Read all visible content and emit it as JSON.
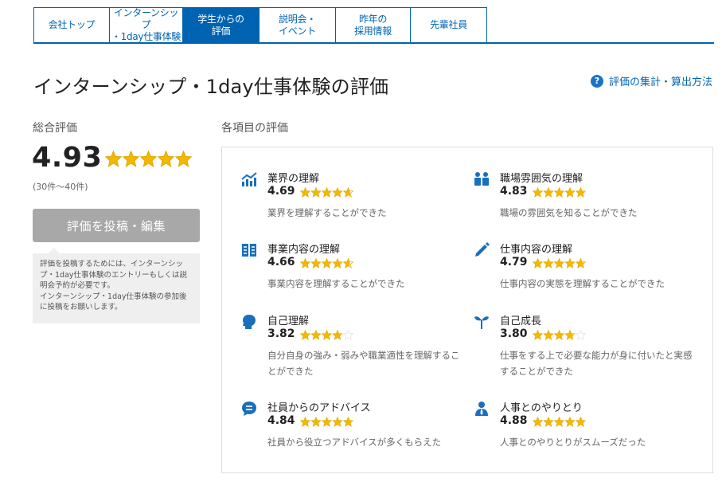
{
  "tabs": [
    {
      "label": "会社トップ",
      "active": false
    },
    {
      "label": "インターンシップ\n・1day仕事体験",
      "active": false
    },
    {
      "label": "学生からの\n評価",
      "active": true
    },
    {
      "label": "説明会・\nイベント",
      "active": false
    },
    {
      "label": "昨年の\n採用情報",
      "active": false
    },
    {
      "label": "先輩社員",
      "active": false
    }
  ],
  "page_title": "インターンシップ・1day仕事体験の評価",
  "method_link": "評価の集計・算出方法",
  "overall": {
    "label": "総合評価",
    "score": "4.93",
    "score_value": 4.93,
    "count": "(30件～40件)",
    "post_button": "評価を投稿・編集",
    "note": "評価を投稿するためには、インターンシップ・1day仕事体験のエントリーもしくは説明会予約が必要です。\nインターンシップ・1day仕事体験の参加後に投稿をお願いします。"
  },
  "items_label": "各項目の評価",
  "items": [
    {
      "icon": "chart-icon",
      "name": "業界の理解",
      "score": "4.69",
      "value": 4.69,
      "desc": "業界を理解することができた"
    },
    {
      "icon": "people-icon",
      "name": "職場雰囲気の理解",
      "score": "4.83",
      "value": 4.83,
      "desc": "職場の雰囲気を知ることができた"
    },
    {
      "icon": "book-icon",
      "name": "事業内容の理解",
      "score": "4.66",
      "value": 4.66,
      "desc": "事業内容を理解することができた"
    },
    {
      "icon": "pencil-icon",
      "name": "仕事内容の理解",
      "score": "4.79",
      "value": 4.79,
      "desc": "仕事内容の実態を理解することができた"
    },
    {
      "icon": "head-icon",
      "name": "自己理解",
      "score": "3.82",
      "value": 3.82,
      "desc": "自分自身の強み・弱みや職業適性を理解することができた"
    },
    {
      "icon": "sprout-icon",
      "name": "自己成長",
      "score": "3.80",
      "value": 3.8,
      "desc": "仕事をする上で必要な能力が身に付いたと実感することができた"
    },
    {
      "icon": "chat-icon",
      "name": "社員からのアドバイス",
      "score": "4.84",
      "value": 4.84,
      "desc": "社員から役立つアドバイスが多くもらえた"
    },
    {
      "icon": "person-icon",
      "name": "人事とのやりとり",
      "score": "4.88",
      "value": 4.88,
      "desc": "人事とのやりとりがスムーズだった"
    }
  ],
  "colors": {
    "accent": "#0063b1",
    "star": "#f5b800",
    "star_empty": "#dddddd"
  }
}
